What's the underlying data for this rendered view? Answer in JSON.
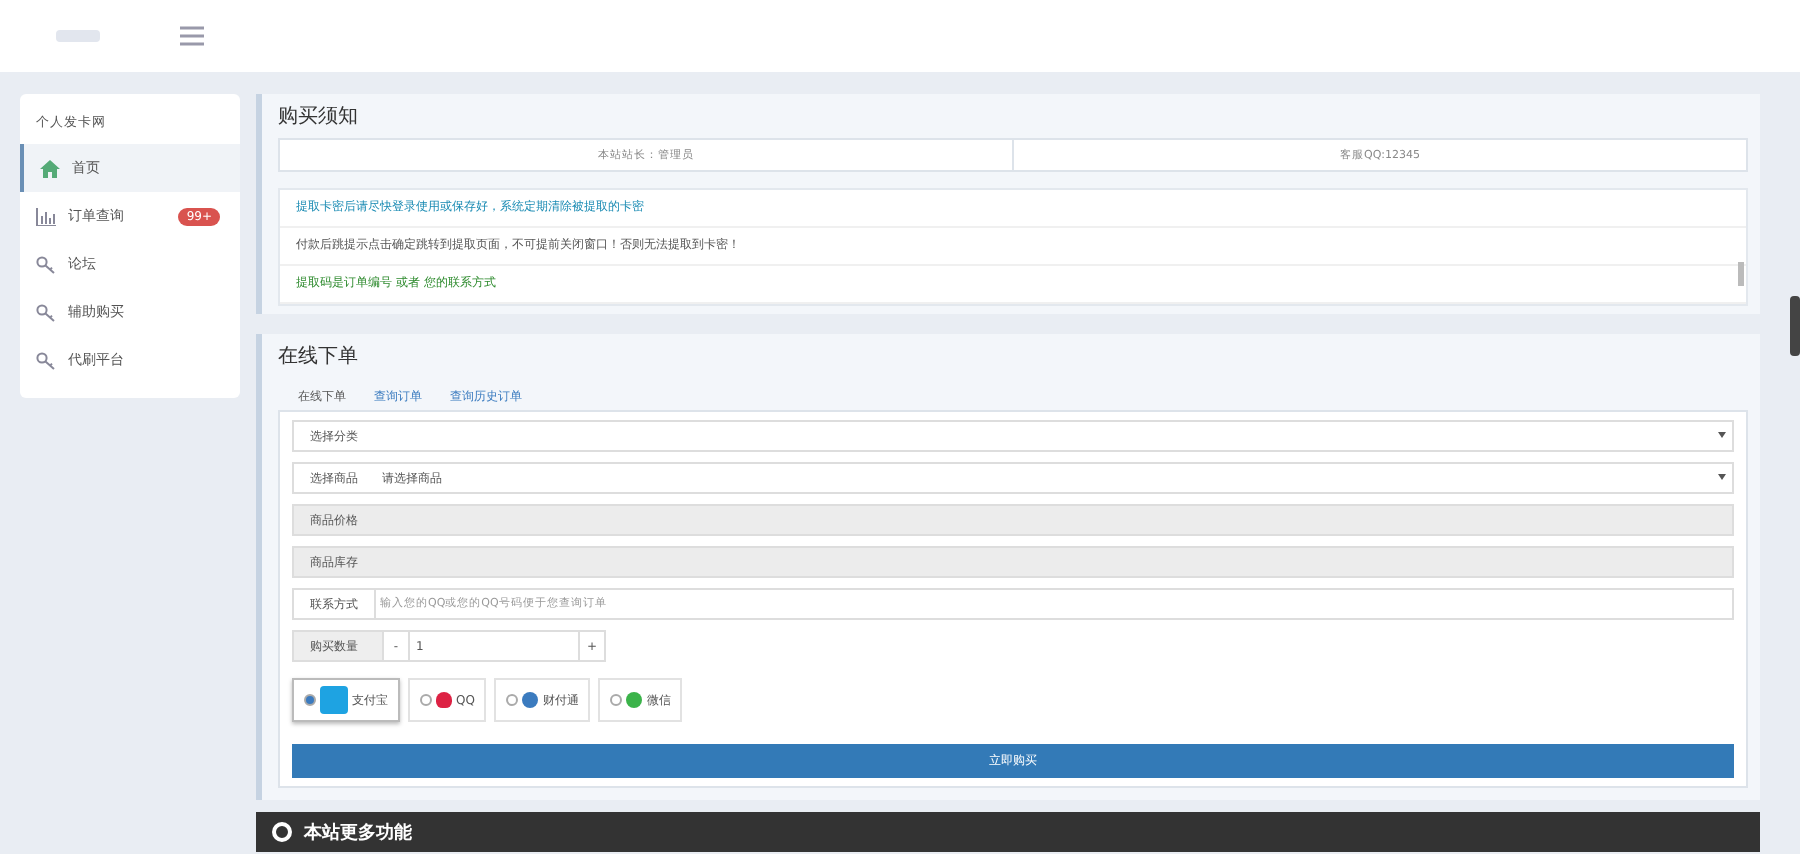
{
  "sidebar": {
    "title": "个人发卡网",
    "items": [
      {
        "label": "首页",
        "kind": "home",
        "selected": true
      },
      {
        "label": "订单查询",
        "kind": "chart",
        "selected": false,
        "badge": "99+"
      },
      {
        "label": "论坛",
        "kind": "key",
        "selected": false
      },
      {
        "label": "辅助购买",
        "kind": "key",
        "selected": false
      },
      {
        "label": "代刷平台",
        "kind": "key",
        "selected": false
      }
    ]
  },
  "notice": {
    "title": "购买须知",
    "info": [
      "本站站长：管理员",
      "客服QQ:12345"
    ],
    "lines": [
      {
        "text": "提取卡密后请尽快登录使用或保存好，系统定期清除被提取的卡密",
        "color": "#1a8bb3"
      },
      {
        "text": "付款后跳提示点击确定跳转到提取页面，不可提前关闭窗口！否则无法提取到卡密！",
        "color": "#555555"
      },
      {
        "text": "提取码是订单编号 或者 您的联系方式",
        "color": "#2e8b2e"
      }
    ]
  },
  "order": {
    "title": "在线下单",
    "tabs": [
      {
        "label": "在线下单",
        "selected": true
      },
      {
        "label": "查询订单",
        "selected": false
      },
      {
        "label": "查询历史订单",
        "selected": false
      }
    ],
    "fields": [
      {
        "kind": "select",
        "label": "选择分类"
      },
      {
        "kind": "select",
        "label": "选择商品",
        "value": "请选择商品"
      },
      {
        "kind": "readonly",
        "label": "商品价格"
      },
      {
        "kind": "readonly",
        "label": "商品库存"
      },
      {
        "kind": "input",
        "label": "联系方式",
        "placeholder": "输入您的QQ或您的QQ号码便于您查询订单"
      },
      {
        "kind": "number",
        "label": "购买数量",
        "minus": "-",
        "value": "1",
        "plus": "+"
      }
    ],
    "payments": [
      {
        "label": "支付宝",
        "kind": "alipay",
        "selected": true
      },
      {
        "label": "QQ",
        "kind": "qq",
        "selected": false
      },
      {
        "label": "财付通",
        "kind": "tenpay",
        "selected": false
      },
      {
        "label": "微信",
        "kind": "wechat",
        "selected": false
      }
    ],
    "submit": "立即购买"
  },
  "more": {
    "title": "本站更多功能"
  }
}
